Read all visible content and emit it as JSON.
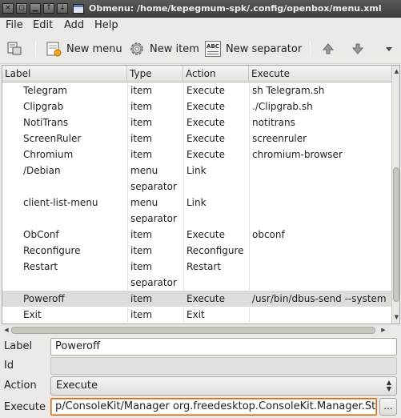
{
  "window": {
    "title": "Obmenu: /home/kepegmum-spk/.config/openbox/menu.xml",
    "buttons": [
      "×",
      "◻",
      "▁",
      "↑",
      "↓"
    ]
  },
  "menubar": [
    "File",
    "Edit",
    "Add",
    "Help"
  ],
  "toolbar": {
    "new_menu": "New menu",
    "new_item": "New item",
    "new_separator": "New separator",
    "sep_icon_text": "ABC"
  },
  "tree": {
    "columns": [
      "Label",
      "Type",
      "Action",
      "Execute"
    ],
    "rows": [
      {
        "label": "Telegram",
        "type": "item",
        "action": "Execute",
        "execute": "sh Telegram.sh"
      },
      {
        "label": "Clipgrab",
        "type": "item",
        "action": "Execute",
        "execute": "./Clipgrab.sh"
      },
      {
        "label": "NotiTrans",
        "type": "item",
        "action": "Execute",
        "execute": "notitrans"
      },
      {
        "label": "ScreenRuler",
        "type": "item",
        "action": "Execute",
        "execute": "screenruler"
      },
      {
        "label": "Chromium",
        "type": "item",
        "action": "Execute",
        "execute": "chromium-browser"
      },
      {
        "label": "/Debian",
        "type": "menu",
        "action": "Link",
        "execute": ""
      },
      {
        "label": "",
        "type": "separator",
        "action": "",
        "execute": ""
      },
      {
        "label": "client-list-menu",
        "type": "menu",
        "action": "Link",
        "execute": ""
      },
      {
        "label": "",
        "type": "separator",
        "action": "",
        "execute": ""
      },
      {
        "label": "ObConf",
        "type": "item",
        "action": "Execute",
        "execute": "obconf"
      },
      {
        "label": "Reconfigure",
        "type": "item",
        "action": "Reconfigure",
        "execute": ""
      },
      {
        "label": "Restart",
        "type": "item",
        "action": "Restart",
        "execute": ""
      },
      {
        "label": "",
        "type": "separator",
        "action": "",
        "execute": ""
      },
      {
        "label": "Poweroff",
        "type": "item",
        "action": "Execute",
        "execute": "/usr/bin/dbus-send --system"
      },
      {
        "label": "Exit",
        "type": "item",
        "action": "Exit",
        "execute": ""
      }
    ],
    "selected_index": 13
  },
  "form": {
    "label_label": "Label",
    "label_value": "Poweroff",
    "id_label": "Id",
    "id_value": "",
    "action_label": "Action",
    "action_value": "Execute",
    "execute_label": "Execute",
    "execute_value": "p/ConsoleKit/Manager org.freedesktop.ConsoleKit.Manager.Stop",
    "browse_button": "..."
  }
}
